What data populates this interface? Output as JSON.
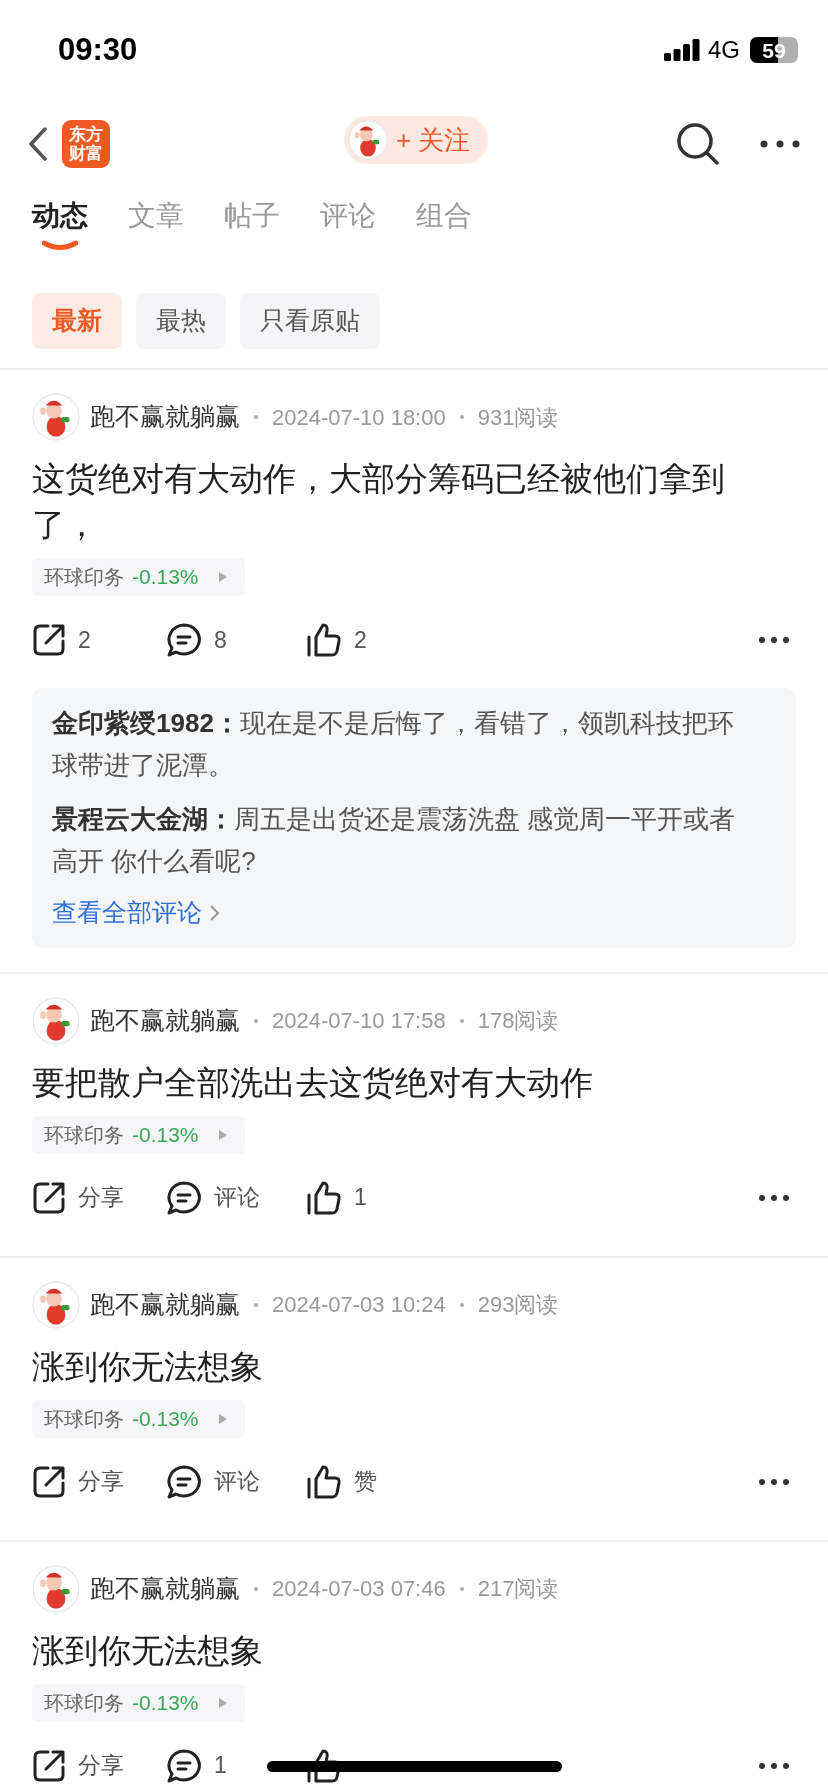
{
  "status_bar": {
    "time": "09:30",
    "network": "4G",
    "battery": "59"
  },
  "nav": {
    "logo": "东方财富",
    "follow_button": "+ 关注"
  },
  "tabs": [
    {
      "label": "动态",
      "selected": true
    },
    {
      "label": "文章",
      "selected": false
    },
    {
      "label": "帖子",
      "selected": false
    },
    {
      "label": "评论",
      "selected": false
    },
    {
      "label": "组合",
      "selected": false
    }
  ],
  "filters": [
    {
      "label": "最新",
      "selected": true
    },
    {
      "label": "最热",
      "selected": false
    },
    {
      "label": "只看原贴",
      "selected": false
    }
  ],
  "posts": [
    {
      "author": "跑不赢就躺赢",
      "time": "2024-07-10 18:00",
      "reads": "931阅读",
      "text": "这货绝对有大动作，大部分筹码已经被他们拿到了，",
      "stock": {
        "name": "环球印务",
        "change": "-0.13%"
      },
      "actions": [
        {
          "kind": "share",
          "label": "2"
        },
        {
          "kind": "comment",
          "label": "8"
        },
        {
          "kind": "like",
          "label": "2"
        }
      ],
      "comments": [
        {
          "author": "金印紫绶1982：",
          "text": "现在是不是后悔了，看错了，领凯科技把环球带进了泥潭。"
        },
        {
          "author": "景程云大金湖：",
          "text": "周五是出货还是震荡洗盘 感觉周一平开或者高开 你什么看呢?"
        }
      ],
      "more_comments": "查看全部评论"
    },
    {
      "author": "跑不赢就躺赢",
      "time": "2024-07-10 17:58",
      "reads": "178阅读",
      "text": "要把散户全部洗出去这货绝对有大动作",
      "stock": {
        "name": "环球印务",
        "change": "-0.13%"
      },
      "actions": [
        {
          "kind": "share",
          "label": "分享"
        },
        {
          "kind": "comment",
          "label": "评论"
        },
        {
          "kind": "like",
          "label": "1"
        }
      ]
    },
    {
      "author": "跑不赢就躺赢",
      "time": "2024-07-03 10:24",
      "reads": "293阅读",
      "text": "涨到你无法想象",
      "stock": {
        "name": "环球印务",
        "change": "-0.13%"
      },
      "actions": [
        {
          "kind": "share",
          "label": "分享"
        },
        {
          "kind": "comment",
          "label": "评论"
        },
        {
          "kind": "like",
          "label": "赞"
        }
      ]
    },
    {
      "author": "跑不赢就躺赢",
      "time": "2024-07-03 07:46",
      "reads": "217阅读",
      "text": "涨到你无法想象",
      "stock": {
        "name": "环球印务",
        "change": "-0.13%"
      },
      "actions": [
        {
          "kind": "share",
          "label": "分享"
        },
        {
          "kind": "comment",
          "label": "1"
        },
        {
          "kind": "like"
        }
      ]
    }
  ]
}
